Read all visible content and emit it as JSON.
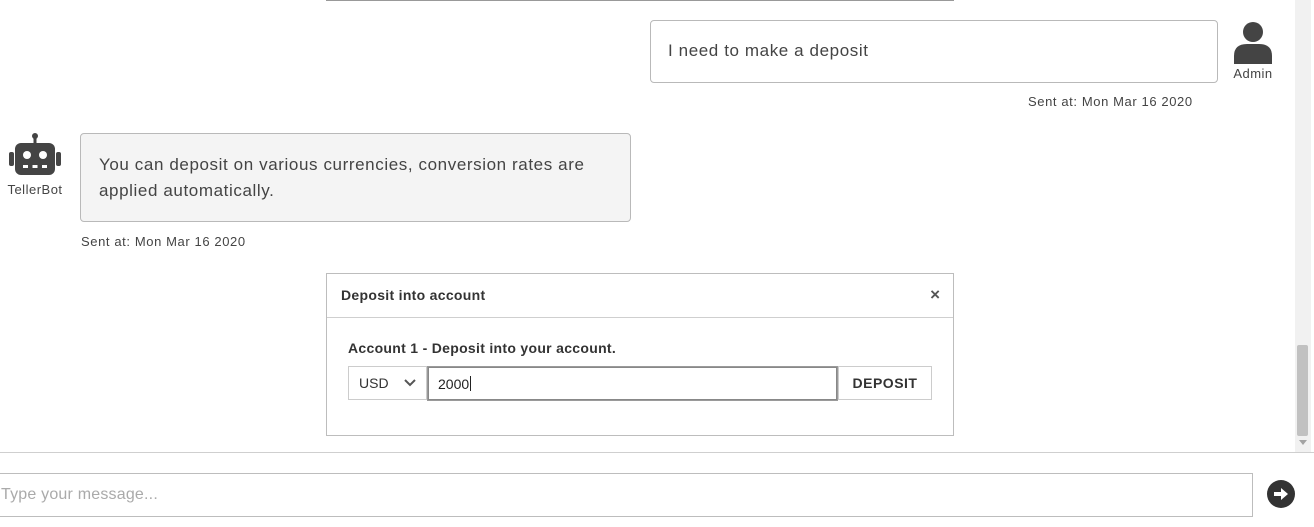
{
  "messages": {
    "user": {
      "text": "I need to make a deposit",
      "sender": "Admin",
      "timestamp": "Sent at: Mon Mar 16 2020"
    },
    "bot": {
      "text": "You can deposit on various currencies, conversion rates are applied automatically.",
      "sender": "TellerBot",
      "timestamp": "Sent at: Mon Mar 16 2020"
    }
  },
  "deposit_modal": {
    "title": "Deposit into account",
    "close_label": "×",
    "subtitle": "Account 1 - Deposit into your account.",
    "currency": "USD",
    "amount": "2000",
    "button_label": "DEPOSIT"
  },
  "composer": {
    "placeholder": "Type your message..."
  },
  "icons": {
    "user_avatar": "user-icon",
    "bot_avatar": "robot-icon",
    "send": "arrow-right-circle-icon",
    "currency_dropdown": "chevron-down-icon"
  },
  "colors": {
    "bot_bubble_bg": "#f4f4f4",
    "icon": "#444444",
    "send_button": "#333333"
  }
}
